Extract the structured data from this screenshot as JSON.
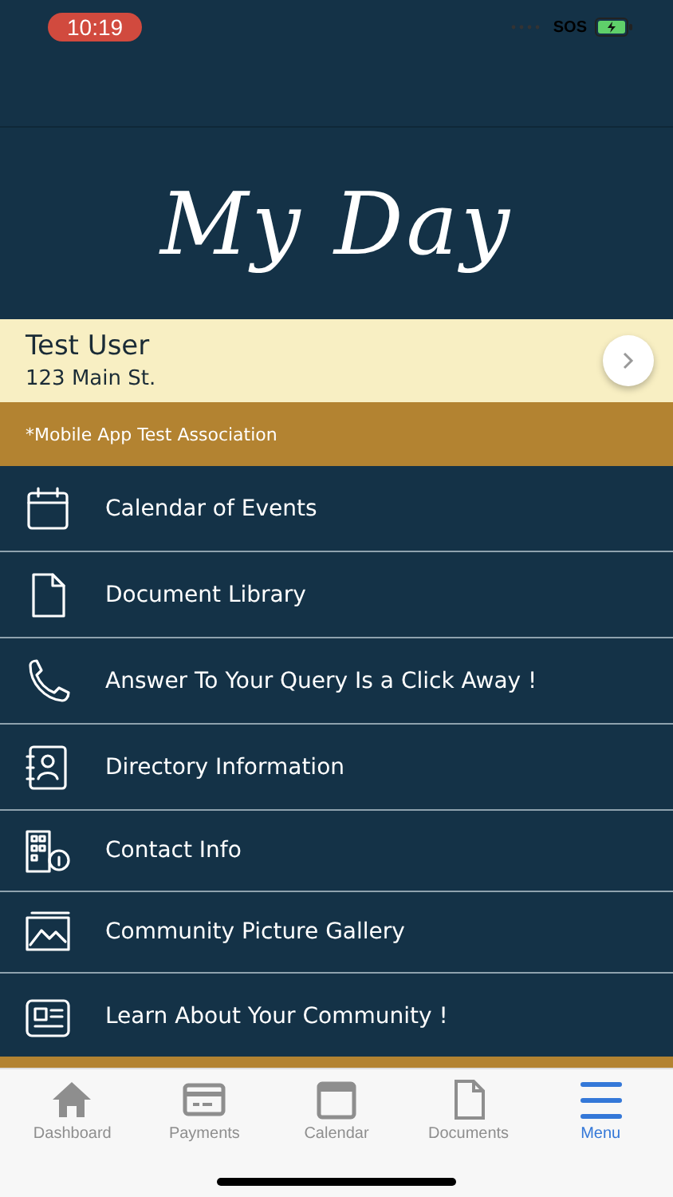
{
  "status_bar": {
    "time": "10:19",
    "carrier": "SOS"
  },
  "logo": "My Day",
  "user": {
    "name": "Test User",
    "address": "123 Main St."
  },
  "association": "*Mobile App Test Association",
  "menu_items": [
    {
      "label": "Calendar of Events"
    },
    {
      "label": "Document Library"
    },
    {
      "label": "Answer To Your Query Is a Click Away !"
    },
    {
      "label": "Directory Information"
    },
    {
      "label": "Contact Info"
    },
    {
      "label": "Community Picture Gallery"
    },
    {
      "label": "Learn About Your Community !"
    }
  ],
  "tab_bar": [
    {
      "label": "Dashboard",
      "selected": false
    },
    {
      "label": "Payments",
      "selected": false
    },
    {
      "label": "Calendar",
      "selected": false
    },
    {
      "label": "Documents",
      "selected": false
    },
    {
      "label": "Menu",
      "selected": true
    }
  ]
}
